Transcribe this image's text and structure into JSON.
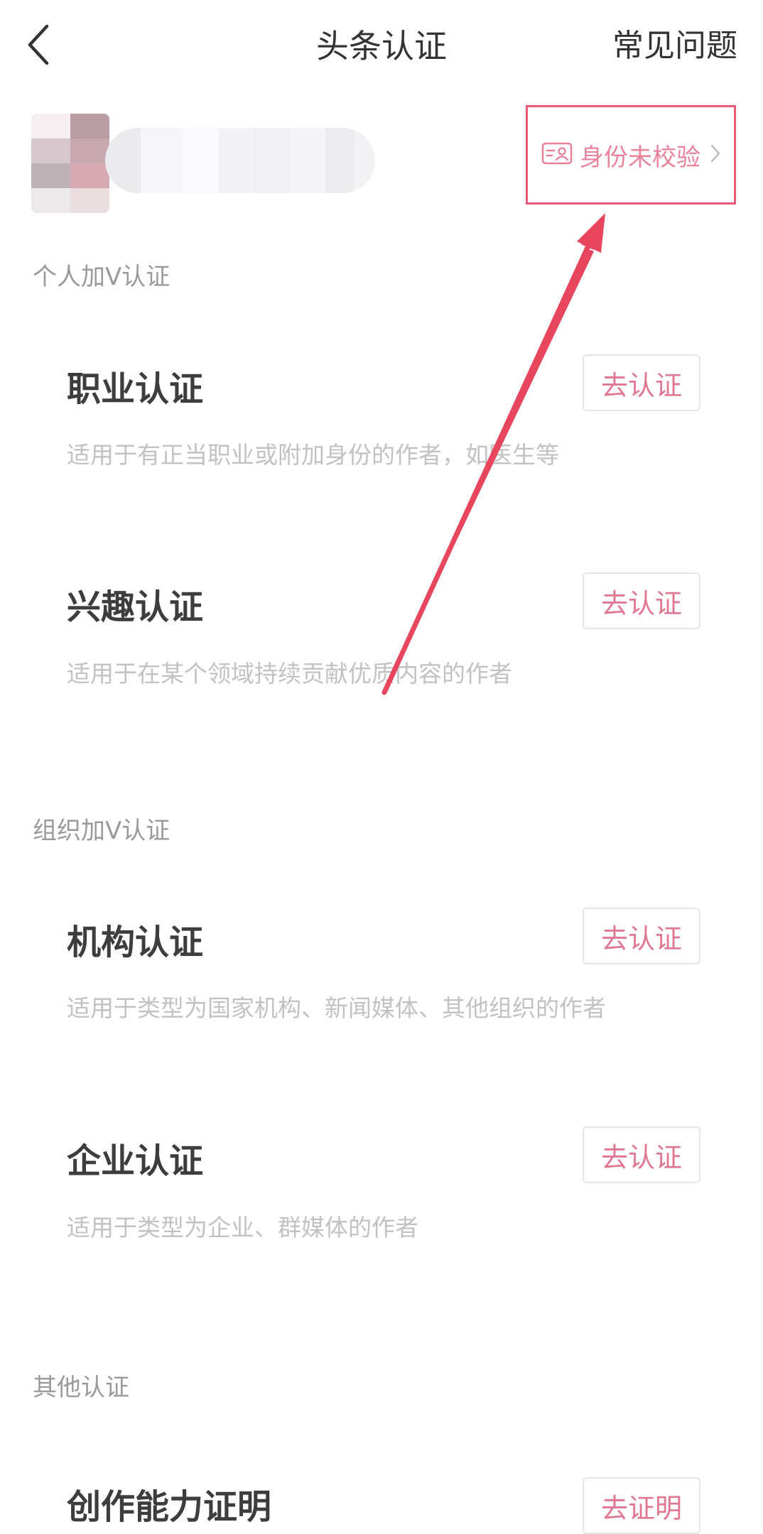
{
  "header": {
    "title": "头条认证",
    "faq": "常见问题"
  },
  "profile": {
    "id_status": "身份未校验"
  },
  "sections": [
    {
      "title": "个人加V认证",
      "items": [
        {
          "title": "职业认证",
          "desc": "适用于有正当职业或附加身份的作者，如医生等",
          "action": "去认证"
        },
        {
          "title": "兴趣认证",
          "desc": "适用于在某个领域持续贡献优质内容的作者",
          "action": "去认证"
        }
      ]
    },
    {
      "title": "组织加V认证",
      "items": [
        {
          "title": "机构认证",
          "desc": "适用于类型为国家机构、新闻媒体、其他组织的作者",
          "action": "去认证"
        },
        {
          "title": "企业认证",
          "desc": "适用于类型为企业、群媒体的作者",
          "action": "去认证"
        }
      ]
    },
    {
      "title": "其他认证",
      "items": [
        {
          "title": "创作能力证明",
          "action": "去证明"
        }
      ]
    }
  ],
  "colors": {
    "accent": "#e07892",
    "annotation": "#e8465e"
  }
}
